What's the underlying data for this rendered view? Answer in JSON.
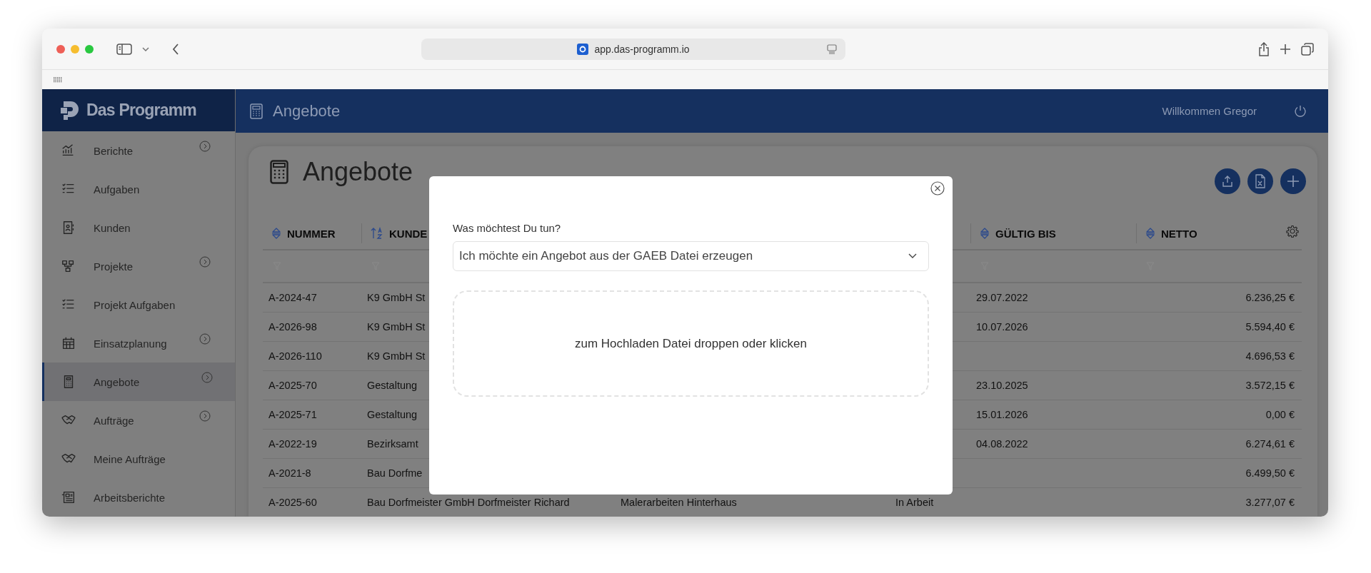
{
  "browser": {
    "url": "app.das-programm.io"
  },
  "app": {
    "logo": "Das Programm",
    "section_title": "Angebote",
    "greeting": "Willkommen Gregor"
  },
  "sidebar": {
    "items": [
      {
        "label": "Berichte",
        "has_submenu": true,
        "selected": false
      },
      {
        "label": "Aufgaben",
        "has_submenu": false,
        "selected": false
      },
      {
        "label": "Kunden",
        "has_submenu": false,
        "selected": false
      },
      {
        "label": "Projekte",
        "has_submenu": true,
        "selected": false
      },
      {
        "label": "Projekt Aufgaben",
        "has_submenu": false,
        "selected": false
      },
      {
        "label": "Einsatzplanung",
        "has_submenu": true,
        "selected": false
      },
      {
        "label": "Angebote",
        "has_submenu": true,
        "selected": true
      },
      {
        "label": "Aufträge",
        "has_submenu": true,
        "selected": false
      },
      {
        "label": "Meine Aufträge",
        "has_submenu": false,
        "selected": false
      },
      {
        "label": "Arbeitsberichte",
        "has_submenu": false,
        "selected": false
      }
    ]
  },
  "page": {
    "title": "Angebote"
  },
  "table": {
    "columns": [
      {
        "label": "NUMMER",
        "sorted": false
      },
      {
        "label": "KUNDE",
        "sorted": true
      },
      {},
      {},
      {
        "label": "GÜLTIG BIS",
        "sorted": false
      },
      {
        "label": "NETTO",
        "sorted": false
      }
    ],
    "rows": [
      {
        "cells": [
          "A-2024-47",
          "K9 GmbH St",
          null,
          null,
          "29.07.2022",
          "6.236,25 €"
        ]
      },
      {
        "cells": [
          "A-2026-98",
          "K9 GmbH St",
          null,
          null,
          "10.07.2026",
          "5.594,40 €"
        ]
      },
      {
        "cells": [
          "A-2026-110",
          "K9 GmbH St",
          null,
          null,
          null,
          "4.696,53 €"
        ]
      },
      {
        "cells": [
          "A-2025-70",
          "Gestaltung",
          null,
          null,
          "23.10.2025",
          "3.572,15 €"
        ]
      },
      {
        "cells": [
          "A-2025-71",
          "Gestaltung",
          null,
          null,
          "15.01.2026",
          "0,00 €"
        ]
      },
      {
        "cells": [
          "A-2022-19",
          "Bezirksamt",
          null,
          null,
          "04.08.2022",
          "6.274,61 €"
        ]
      },
      {
        "cells": [
          "A-2021-8",
          "Bau Dorfme",
          null,
          null,
          null,
          "6.499,50 €"
        ]
      },
      {
        "cells": [
          "A-2025-60",
          "Bau Dorfmeister GmbH Dorfmeister Richard",
          "Malerarbeiten Hinterhaus",
          "In Arbeit",
          null,
          "3.277,07 €"
        ]
      }
    ]
  },
  "dialog": {
    "label": "Was möchtest Du tun?",
    "selection": "Ich möchte ein Angebot aus der GAEB Datei erzeugen",
    "dropzone": "zum Hochladen Datei droppen oder klicken"
  }
}
